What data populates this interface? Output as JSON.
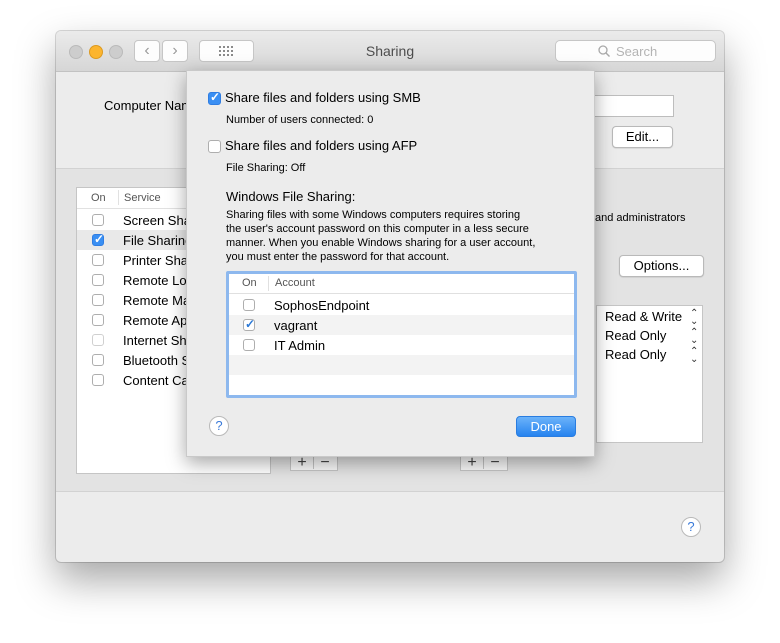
{
  "window": {
    "title": "Sharing"
  },
  "search": {
    "placeholder": "Search",
    "icon": "magnifier-icon"
  },
  "computer_name_label": "Computer Nam",
  "edit_button": "Edit...",
  "options_button": "Options...",
  "services": {
    "header_on": "On",
    "header_service": "Service",
    "items": [
      {
        "label": "Screen Sha",
        "checked": false
      },
      {
        "label": "File Sharing",
        "checked": true
      },
      {
        "label": "Printer Sha",
        "checked": false
      },
      {
        "label": "Remote Log",
        "checked": false
      },
      {
        "label": "Remote Ma",
        "checked": false
      },
      {
        "label": "Remote App",
        "checked": false
      },
      {
        "label": "Internet Sh",
        "checked": false
      },
      {
        "label": "Bluetooth S",
        "checked": false
      },
      {
        "label": "Content Ca",
        "checked": false
      }
    ]
  },
  "right_panel": {
    "admins_text": "and administrators",
    "permissions": [
      "Read & Write",
      "Read Only",
      "Read Only"
    ]
  },
  "sheet": {
    "smb": {
      "label": "Share files and folders using SMB",
      "checked": true,
      "status": "Number of users connected: 0"
    },
    "afp": {
      "label": "Share files and folders using AFP",
      "checked": false,
      "status": "File Sharing: Off"
    },
    "windows_heading": "Windows File Sharing:",
    "windows_desc_lines": [
      "Sharing files with some Windows computers requires storing",
      "the user's account password on this computer in a less secure",
      "manner.  When you enable Windows sharing for a user account,",
      "you must enter the password for that account."
    ],
    "accounts": {
      "header_on": "On",
      "header_account": "Account",
      "rows": [
        {
          "name": "SophosEndpoint",
          "checked": false
        },
        {
          "name": "vagrant",
          "checked": true
        },
        {
          "name": "IT Admin",
          "checked": false
        }
      ]
    },
    "help": "?",
    "done_button": "Done"
  },
  "colors": {
    "accent": "#2683ef",
    "checkbox_blue": "#3a8ff3"
  }
}
